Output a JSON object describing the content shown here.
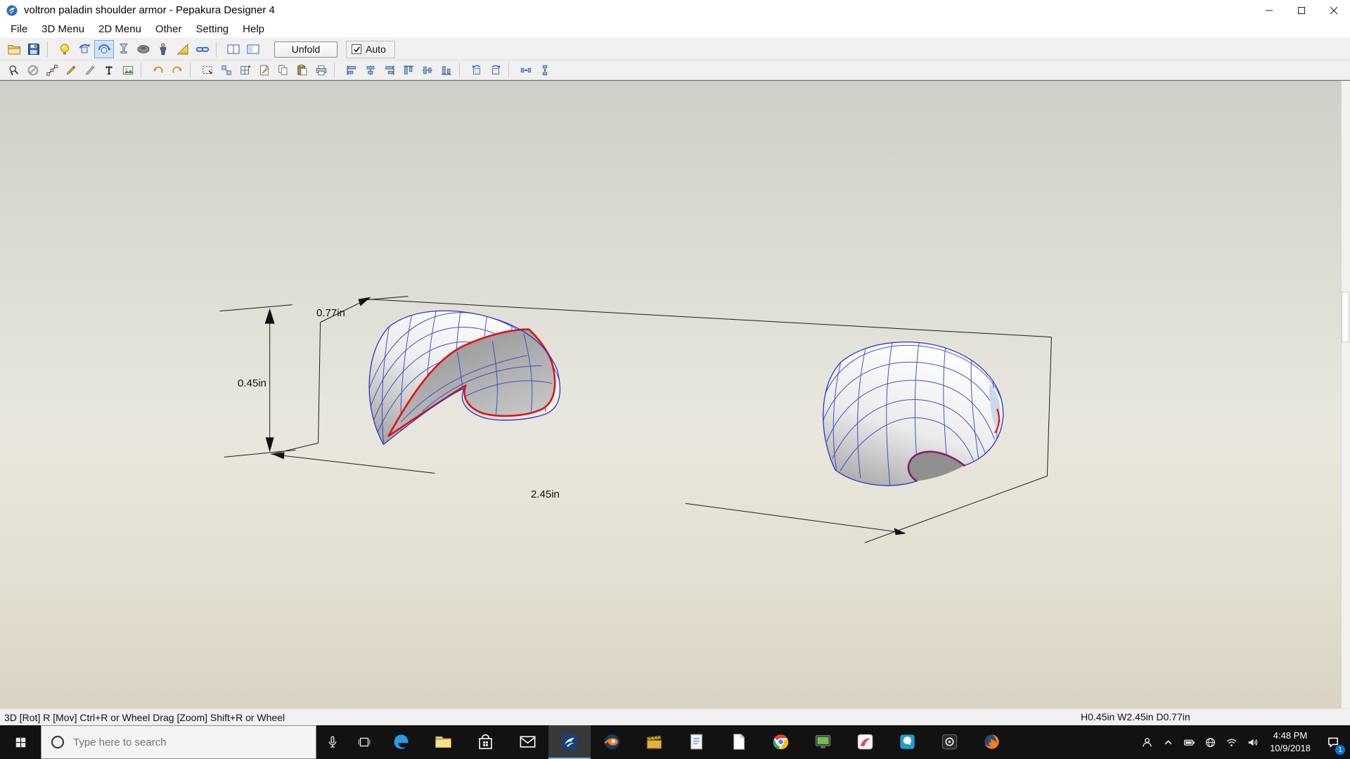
{
  "titlebar": {
    "title": "voltron paladin shoulder armor - Pepakura Designer 4"
  },
  "menubar": {
    "items": [
      {
        "label": "File"
      },
      {
        "label": "3D Menu"
      },
      {
        "label": "2D Menu"
      },
      {
        "label": "Other"
      },
      {
        "label": "Setting"
      },
      {
        "label": "Help"
      }
    ]
  },
  "toolbar_top": {
    "buttons": [
      {
        "icon": "open-folder-icon"
      },
      {
        "icon": "save-icon"
      },
      {
        "icon": "separator"
      },
      {
        "icon": "light-bulb-icon"
      },
      {
        "icon": "rotate-object-icon"
      },
      {
        "icon": "rotate-view-icon",
        "active": true
      },
      {
        "icon": "goblet-icon"
      },
      {
        "icon": "solid-view-icon"
      },
      {
        "icon": "figure-icon"
      },
      {
        "icon": "ruler-icon"
      },
      {
        "icon": "link-icon"
      },
      {
        "icon": "separator"
      },
      {
        "icon": "split-view-icon"
      },
      {
        "icon": "single-view-icon"
      }
    ],
    "unfold_label": "Unfold",
    "auto": {
      "label": "Auto",
      "checked": true
    }
  },
  "toolbar_edit": {
    "buttons": [
      {
        "icon": "select-icon"
      },
      {
        "icon": "disable-edit-icon"
      },
      {
        "icon": "edge-edit-icon"
      },
      {
        "icon": "pen-icon"
      },
      {
        "icon": "knife-icon"
      },
      {
        "icon": "text-icon"
      },
      {
        "icon": "image-icon"
      },
      {
        "icon": "separator"
      },
      {
        "icon": "undo-icon"
      },
      {
        "icon": "redo-icon"
      },
      {
        "icon": "separator"
      },
      {
        "icon": "select-window-icon"
      },
      {
        "icon": "move-part-icon"
      },
      {
        "icon": "divide-icon"
      },
      {
        "icon": "note-icon"
      },
      {
        "icon": "copy-page-icon"
      },
      {
        "icon": "paste-icon"
      },
      {
        "icon": "print-icon"
      },
      {
        "icon": "separator"
      },
      {
        "icon": "align-left-icon"
      },
      {
        "icon": "align-center-h-icon"
      },
      {
        "icon": "align-right-icon"
      },
      {
        "icon": "align-top-icon"
      },
      {
        "icon": "align-middle-v-icon"
      },
      {
        "icon": "align-bottom-icon"
      },
      {
        "icon": "separator"
      },
      {
        "icon": "rotate-left-icon"
      },
      {
        "icon": "rotate-right-icon"
      },
      {
        "icon": "separator"
      },
      {
        "icon": "distribute-h-icon"
      },
      {
        "icon": "distribute-v-icon"
      }
    ]
  },
  "viewport": {
    "dim_height": "0.45in",
    "dim_width": "2.45in",
    "dim_depth": "0.77in",
    "mesh_count": 2,
    "wireframe_color": "#2734c4",
    "open_edge_color": "#e11212"
  },
  "statusbar": {
    "left": "3D [Rot] R [Mov] Ctrl+R or Wheel Drag [Zoom] Shift+R or Wheel",
    "right": "H0.45in W2.45in D0.77in"
  },
  "taskbar": {
    "search_placeholder": "Type here to search",
    "apps": [
      {
        "icon": "edge-icon"
      },
      {
        "icon": "file-explorer-icon"
      },
      {
        "icon": "store-icon"
      },
      {
        "icon": "mail-icon"
      },
      {
        "icon": "pepakura-icon",
        "active": true
      },
      {
        "icon": "blender-icon"
      },
      {
        "icon": "clapperboard-icon"
      },
      {
        "icon": "notepad-icon"
      },
      {
        "icon": "document-icon"
      },
      {
        "icon": "chrome-icon"
      },
      {
        "icon": "capture-icon"
      },
      {
        "icon": "paint-icon"
      },
      {
        "icon": "chat-icon"
      },
      {
        "icon": "media-icon"
      },
      {
        "icon": "firefox-icon"
      }
    ],
    "tray_icons": [
      {
        "icon": "user-icon"
      },
      {
        "icon": "chevron-up-icon"
      },
      {
        "icon": "battery-icon"
      },
      {
        "icon": "globe-icon"
      },
      {
        "icon": "wifi-icon"
      },
      {
        "icon": "volume-icon"
      }
    ],
    "clock": {
      "time": "4:48 PM",
      "date": "10/9/2018"
    },
    "notification_badge": "1"
  }
}
